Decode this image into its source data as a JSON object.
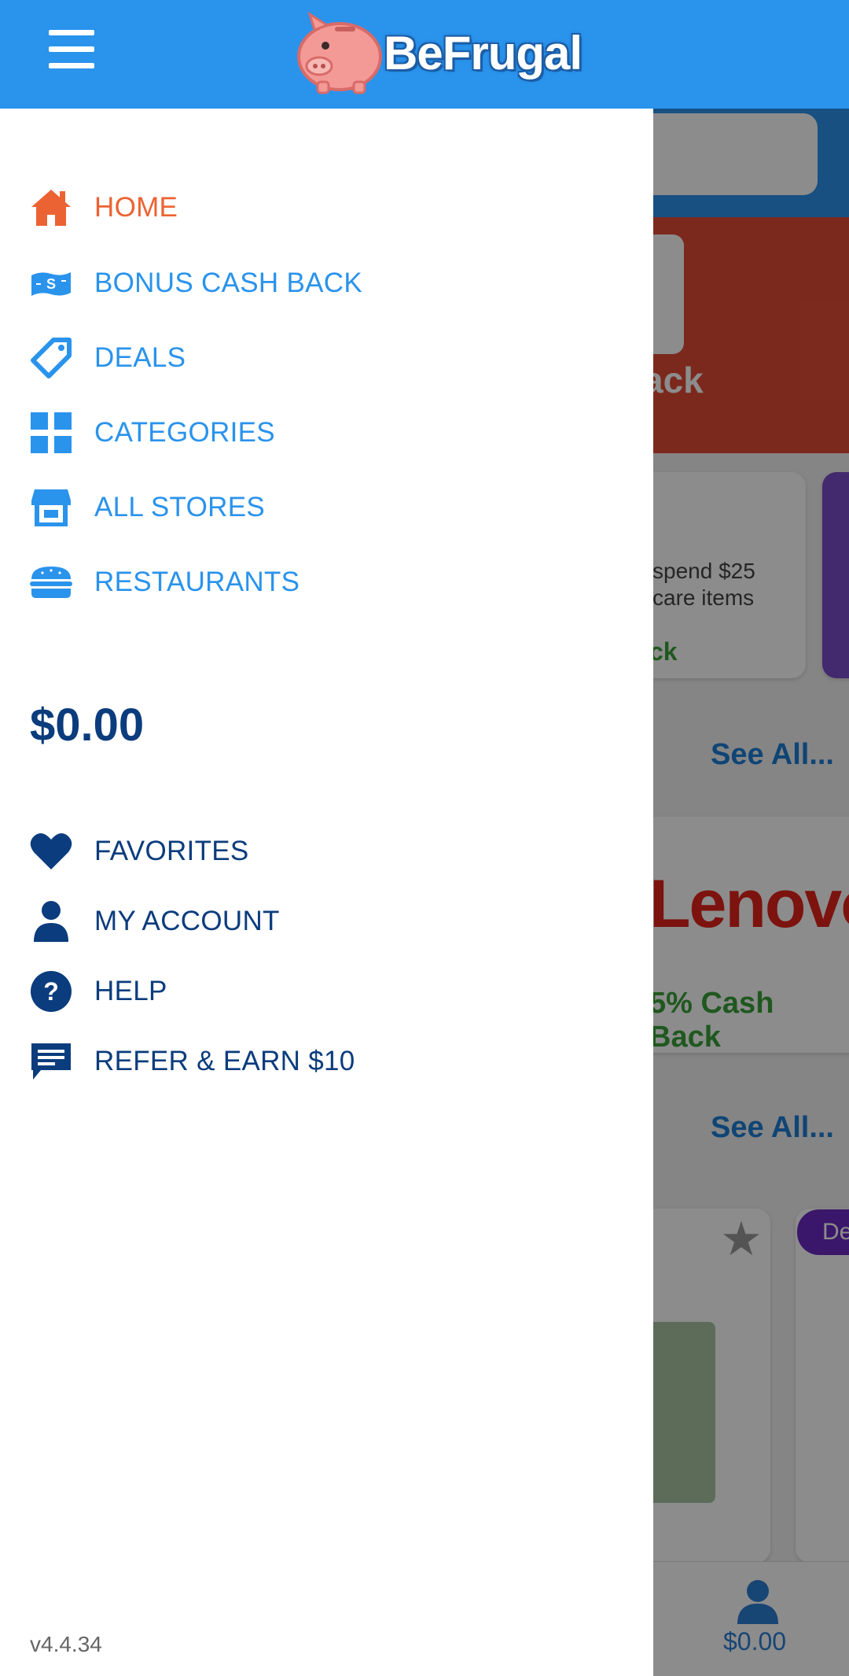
{
  "app": {
    "name": "BeFrugal",
    "accent": "#2a93ec",
    "active_color": "#ec6333",
    "dark_blue": "#0b3c7d"
  },
  "header": {
    "logo_text": "BeFrugal"
  },
  "drawer": {
    "primary_items": [
      {
        "label": "HOME",
        "icon": "home-icon",
        "active": true
      },
      {
        "label": "BONUS CASH BACK",
        "icon": "cash-icon",
        "active": false
      },
      {
        "label": "DEALS",
        "icon": "tag-icon",
        "active": false
      },
      {
        "label": "CATEGORIES",
        "icon": "grid-icon",
        "active": false
      },
      {
        "label": "ALL STORES",
        "icon": "store-icon",
        "active": false
      },
      {
        "label": "RESTAURANTS",
        "icon": "burger-icon",
        "active": false
      }
    ],
    "balance": "$0.00",
    "secondary_items": [
      {
        "label": "FAVORITES",
        "icon": "heart-icon"
      },
      {
        "label": "MY ACCOUNT",
        "icon": "person-icon"
      },
      {
        "label": "HELP",
        "icon": "question-icon"
      },
      {
        "label": "REFER & EARN $10",
        "icon": "chat-icon"
      }
    ],
    "version": "v4.4.34"
  },
  "background": {
    "hero_text": "ack",
    "card_text_1": "spend $25",
    "card_text_2": "care items",
    "card_cash": "ck",
    "see_all": "See All...",
    "brand": "Lenovo",
    "brand_cash": "5% Cash Back",
    "badge": "De",
    "bottom_balance": "$0.00"
  }
}
